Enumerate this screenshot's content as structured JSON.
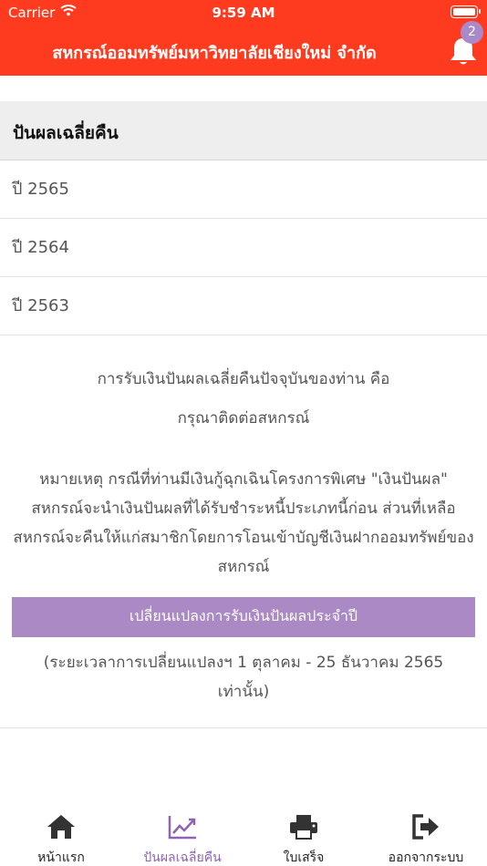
{
  "status": {
    "carrier": "Carrier",
    "time": "9:59 AM"
  },
  "header": {
    "title": "สหกรณ์ออมทรัพย์มหาวิทยาลัยเชียงใหม่ จำกัด",
    "notification_count": "2"
  },
  "section": {
    "title": "ปันผลเฉลี่ยคืน"
  },
  "years": [
    "ปี 2565",
    "ปี 2564",
    "ปี 2563"
  ],
  "info": {
    "line1": "การรับเงินปันผลเฉลี่ยคืนปัจจุบันของท่าน คือ",
    "line2": "กรุณาติดต่อสหกรณ์",
    "note": "หมายเหตุ กรณีที่ท่านมีเงินกู้ฉุกเฉินโครงการพิเศษ \"เงินปันผล\" สหกรณ์จะนำเงินปันผลที่ได้รับชำระหนี้ประเภทนี้ก่อน ส่วนที่เหลือสหกรณ์จะคืนให้แก่สมาชิกโดยการโอนเข้าบัญชีเงินฝากออมทรัพย์ของสหกรณ์"
  },
  "actions": {
    "change_label": "เปลี่ยนแปลงการรับเงินปันผลประจำปี"
  },
  "period": "(ระยะเวลาการเปลี่ยนแปลงฯ 1 ตุลาคม - 25 ธันวาคม 2565 เท่านั้น)",
  "tabs": [
    {
      "label": "หน้าแรก",
      "icon": "home-icon"
    },
    {
      "label": "ปันผลเฉลี่ยคืน",
      "icon": "chart-line-icon"
    },
    {
      "label": "ใบเสร็จ",
      "icon": "printer-icon"
    },
    {
      "label": "ออกจากระบบ",
      "icon": "sign-out-icon"
    }
  ],
  "colors": {
    "header": "#ff3b1f",
    "accent": "#ab89c4",
    "active_tab": "#8e63b2",
    "badge": "#a989c7"
  }
}
